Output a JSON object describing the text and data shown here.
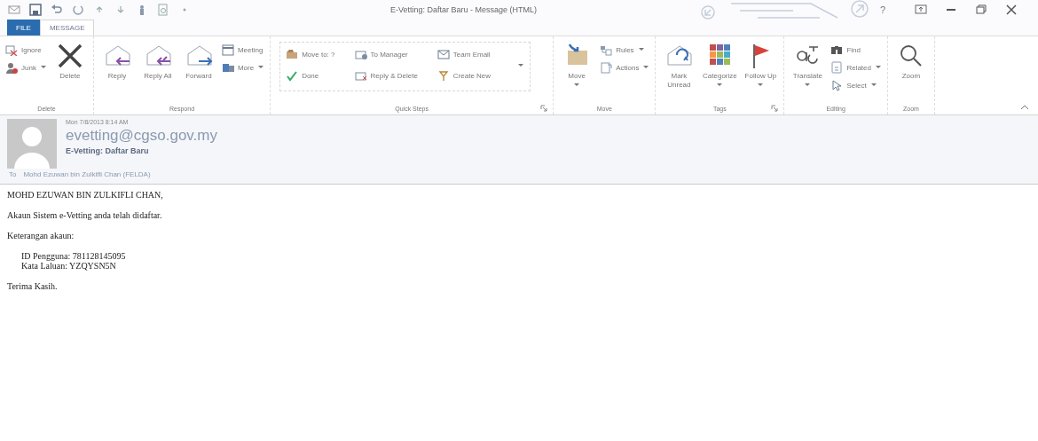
{
  "window": {
    "title": "E-Vetting: Daftar Baru - Message (HTML)",
    "help": "?"
  },
  "tabs": [
    {
      "label": "FILE",
      "kind": "file",
      "selected": false
    },
    {
      "label": "MESSAGE",
      "kind": "tab",
      "selected": true
    }
  ],
  "ribbon": [
    {
      "label": "Delete",
      "launcher": false,
      "items": [
        {
          "label": "Ignore",
          "kind": "small",
          "dropdown": false
        },
        {
          "label": "Junk",
          "kind": "small",
          "dropdown": true
        },
        {
          "label": "Delete",
          "kind": "large",
          "dropdown": false
        }
      ]
    },
    {
      "label": "Respond",
      "launcher": false,
      "items": [
        {
          "label": "Reply",
          "kind": "large",
          "dropdown": false
        },
        {
          "label": "Reply All",
          "kind": "large",
          "dropdown": false
        },
        {
          "label": "Forward",
          "kind": "large",
          "dropdown": false
        },
        {
          "label": "Meeting",
          "kind": "small",
          "dropdown": false
        },
        {
          "label": "More",
          "kind": "small",
          "dropdown": true
        }
      ]
    },
    {
      "label": "Quick Steps",
      "launcher": true,
      "items": [
        {
          "label": "Move to: ?",
          "kind": "quickstep",
          "dropdown": false
        },
        {
          "label": "Done",
          "kind": "quickstep",
          "dropdown": false
        },
        {
          "label": "To Manager",
          "kind": "quickstep",
          "dropdown": false
        },
        {
          "label": "Reply & Delete",
          "kind": "quickstep",
          "dropdown": false
        },
        {
          "label": "Team Email",
          "kind": "quickstep",
          "dropdown": false
        },
        {
          "label": "Create New",
          "kind": "quickstep",
          "dropdown": false
        }
      ]
    },
    {
      "label": "Move",
      "launcher": false,
      "items": [
        {
          "label": "Move",
          "kind": "large",
          "dropdown": true
        },
        {
          "label": "Rules",
          "kind": "small",
          "dropdown": true
        },
        {
          "label": "Actions",
          "kind": "small",
          "dropdown": true
        }
      ]
    },
    {
      "label": "Tags",
      "launcher": true,
      "items": [
        {
          "label": "Mark Unread",
          "kind": "large",
          "dropdown": false
        },
        {
          "label": "Categorize",
          "kind": "large",
          "dropdown": true
        },
        {
          "label": "Follow Up",
          "kind": "large",
          "dropdown": true
        }
      ]
    },
    {
      "label": "Editing",
      "launcher": false,
      "items": [
        {
          "label": "Translate",
          "kind": "large",
          "dropdown": true
        },
        {
          "label": "Find",
          "kind": "small",
          "dropdown": false
        },
        {
          "label": "Related",
          "kind": "small",
          "dropdown": true
        },
        {
          "label": "Select",
          "kind": "small",
          "dropdown": true
        }
      ]
    },
    {
      "label": "Zoom",
      "launcher": false,
      "items": [
        {
          "label": "Zoom",
          "kind": "large",
          "dropdown": false
        }
      ]
    }
  ],
  "header": {
    "date": "Mon 7/8/2013 8:14 AM",
    "sender": "evetting@cgso.gov.my",
    "subject": "E-Vetting: Daftar Baru",
    "to_label": "To",
    "recipient": "Mohd Ezuwan bin Zulkifli Chan (FELDA)"
  },
  "body": [
    {
      "kind": "para",
      "lines": [
        "MOHD EZUWAN BIN ZULKIFLI CHAN,"
      ]
    },
    {
      "kind": "para",
      "lines": [
        "Akaun Sistem e-Vetting anda telah didaftar."
      ]
    },
    {
      "kind": "para",
      "lines": [
        "Keterangan akaun:"
      ]
    },
    {
      "kind": "indent",
      "lines": [
        "ID Pengguna: 781128145095",
        "Kata Laluan: YZQYSN5N"
      ]
    },
    {
      "kind": "para",
      "lines": [
        "Terima Kasih."
      ]
    }
  ]
}
